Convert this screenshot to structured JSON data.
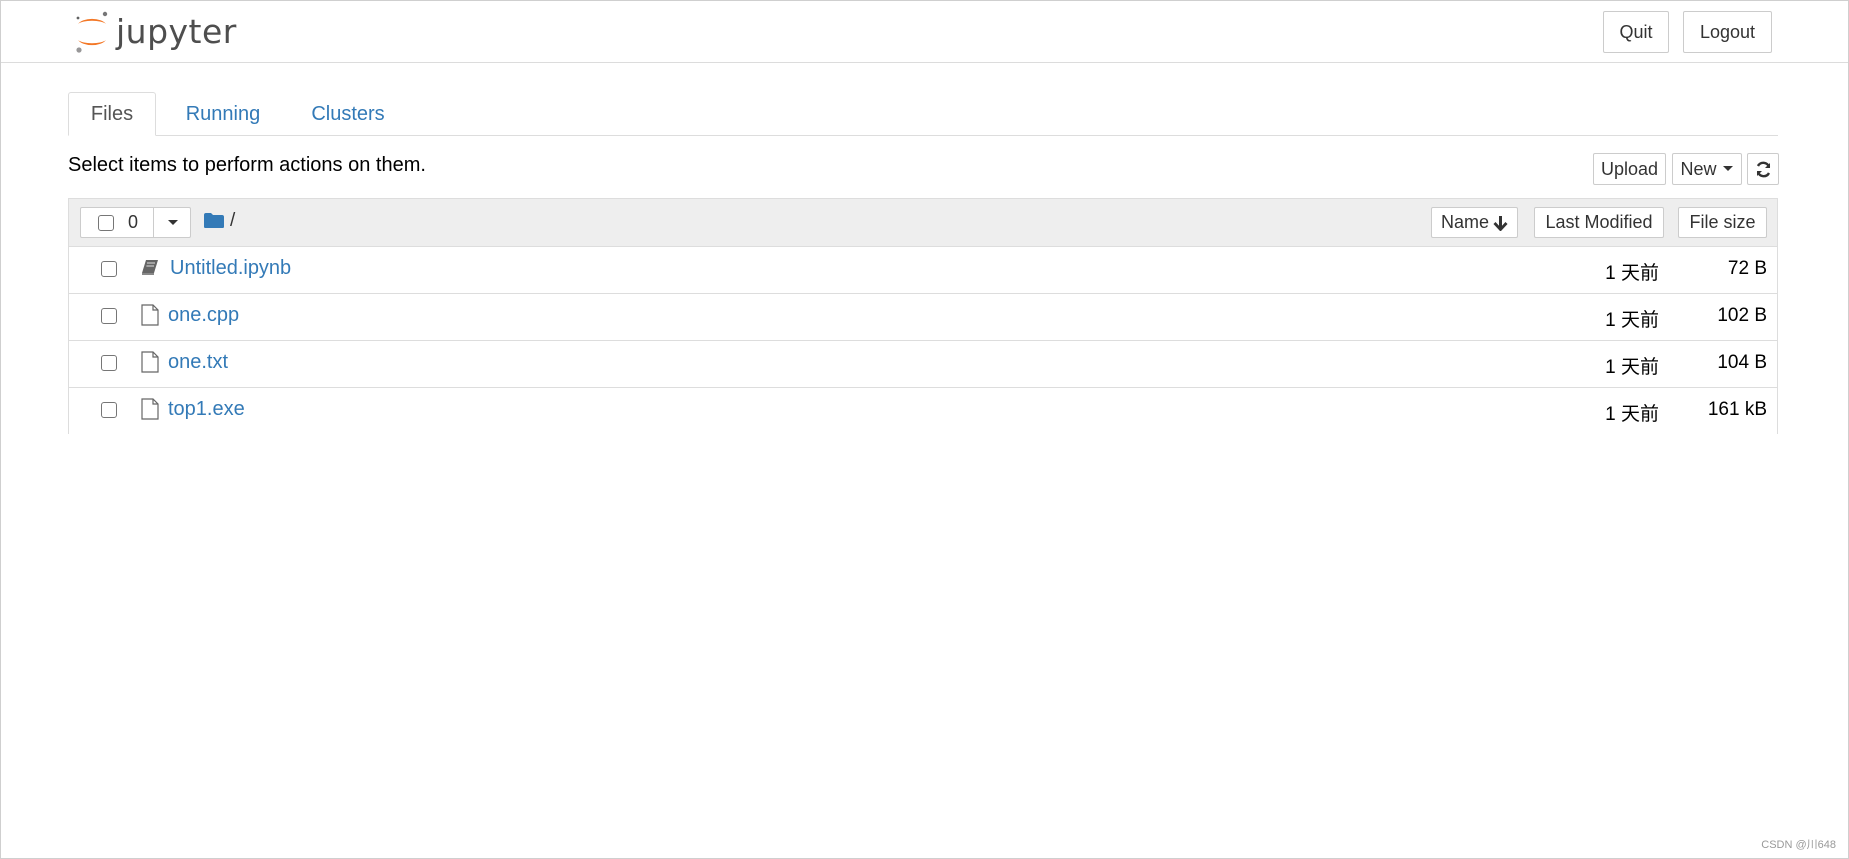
{
  "header": {
    "logo_text": "jupyter",
    "quit_label": "Quit",
    "logout_label": "Logout"
  },
  "tabs": [
    {
      "label": "Files",
      "active": true
    },
    {
      "label": "Running",
      "active": false
    },
    {
      "label": "Clusters",
      "active": false
    }
  ],
  "toolbar": {
    "hint": "Select items to perform actions on them.",
    "upload_label": "Upload",
    "new_label": "New"
  },
  "list_header": {
    "selected_count": "0",
    "path": "/",
    "sort_name_label": "Name",
    "sort_modified_label": "Last Modified",
    "sort_size_label": "File size"
  },
  "files": [
    {
      "name": "Untitled.ipynb",
      "icon": "notebook-icon",
      "modified": "1 天前",
      "size": "72 B"
    },
    {
      "name": "one.cpp",
      "icon": "file-icon",
      "modified": "1 天前",
      "size": "102 B"
    },
    {
      "name": "one.txt",
      "icon": "file-icon",
      "modified": "1 天前",
      "size": "104 B"
    },
    {
      "name": "top1.exe",
      "icon": "file-icon",
      "modified": "1 天前",
      "size": "161 kB"
    }
  ],
  "watermark": "CSDN @川648",
  "colors": {
    "link": "#337ab7",
    "logo_orange": "#f37726",
    "header_bg": "#eeeeee"
  }
}
